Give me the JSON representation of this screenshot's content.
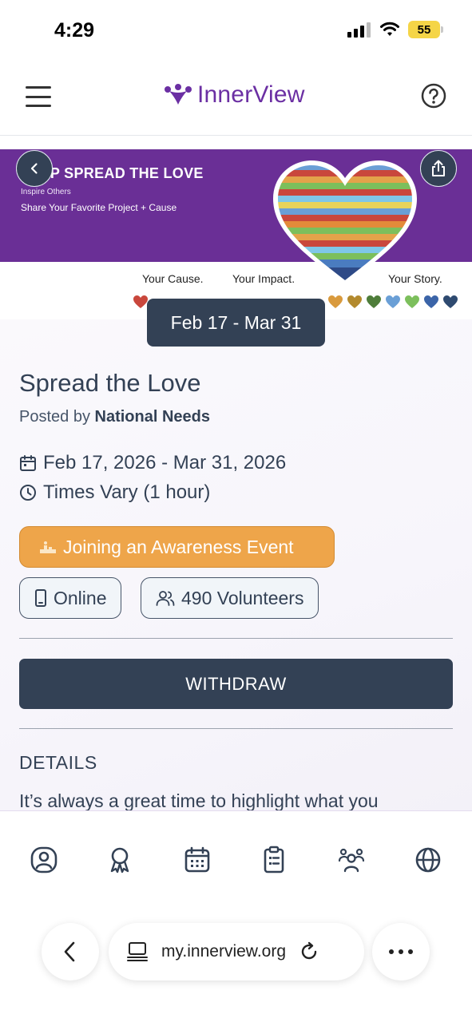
{
  "status_bar": {
    "time": "4:29",
    "battery": "55"
  },
  "nav": {
    "brand": "InnerView"
  },
  "hero": {
    "title": "HELP SPREAD THE LOVE",
    "subtitle": "Inspire Others",
    "tagline": "Share Your Favorite Project + Cause",
    "taglines": [
      "Your Cause.",
      "Your Impact.",
      "Your Story."
    ]
  },
  "date_chip": "Feb 17 - Mar 31",
  "event": {
    "title": "Spread the Love",
    "posted_by_prefix": "Posted by",
    "posted_by": "National Needs",
    "date_range": "Feb 17, 2026 - Mar 31, 2026",
    "time": "Times Vary (1 hour)",
    "category": "Joining an Awareness Event",
    "location": "Online",
    "volunteers": "490 Volunteers"
  },
  "withdraw_label": "WITHDRAW",
  "details": {
    "heading": "DETAILS",
    "text": "It’s always a great time to highlight what you"
  },
  "tabs": [
    "profile-icon",
    "award-icon",
    "calendar-icon",
    "clipboard-icon",
    "group-icon",
    "globe-icon"
  ],
  "browser": {
    "url": "my.innerview.org"
  },
  "colors": {
    "brand": "#6b2fa3",
    "primary": "#334155",
    "accent": "#eea54a"
  }
}
